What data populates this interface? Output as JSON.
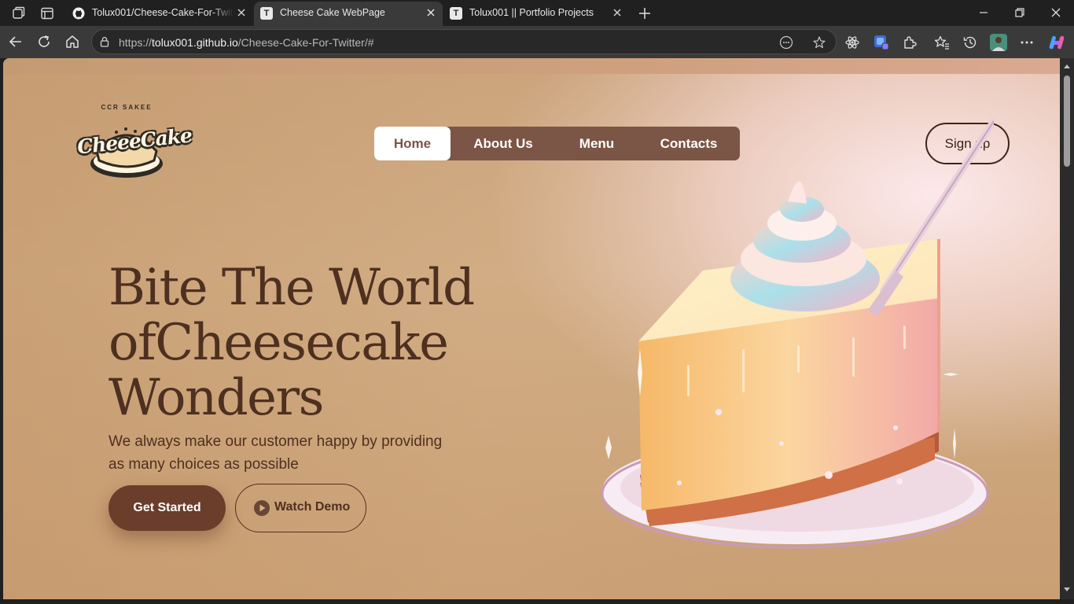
{
  "browser": {
    "tabs": [
      {
        "title": "Tolux001/Cheese-Cake-For-Twitte",
        "favicon": "github-icon",
        "active": false
      },
      {
        "title": "Cheese Cake WebPage",
        "favicon": "T",
        "active": true
      },
      {
        "title": "Tolux001 || Portfolio Projects",
        "favicon": "T",
        "active": false
      }
    ],
    "url_prefix": "https://",
    "url_host": "tolux001.github.io",
    "url_path": "/Cheese-Cake-For-Twitter/#"
  },
  "site": {
    "logo": {
      "arc_text": "CCR SAKEE",
      "wordmark": "CheeeCake"
    },
    "nav": [
      {
        "label": "Home",
        "active": true
      },
      {
        "label": "About Us",
        "active": false
      },
      {
        "label": "Menu",
        "active": false
      },
      {
        "label": "Contacts",
        "active": false
      }
    ],
    "signup": "Sign up",
    "hero": {
      "title_lines": [
        "Bite The World",
        "ofCheesecake",
        "Wonders"
      ],
      "subtitle_line1": "We always make our customer happy by providing",
      "subtitle_line2": "as many choices as possible",
      "primary_button": "Get Started",
      "secondary_button": "Watch Demo"
    }
  },
  "colors": {
    "brand_brown": "#6a3e2a",
    "nav_bg": "#7b5545",
    "text_brown": "#4e3020"
  }
}
